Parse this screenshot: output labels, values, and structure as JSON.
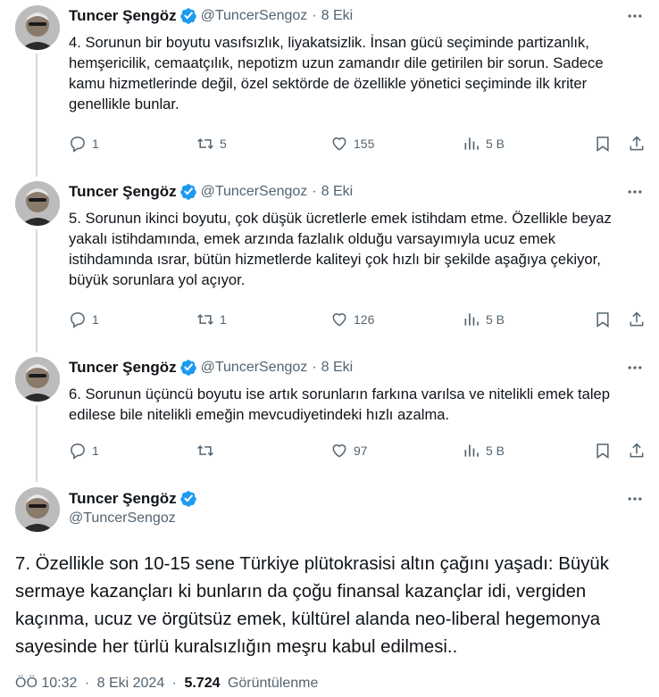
{
  "author": {
    "name": "Tuncer Şengöz",
    "handle": "@TuncerSengoz",
    "verified_color": "#1d9bf0"
  },
  "tweets": [
    {
      "date": "8 Eki",
      "text": "4. Sorunun bir boyutu vasıfsızlık, liyakatsizlik. İnsan gücü seçiminde partizanlık, hemşericilik, cemaatçılık, nepotizm uzun zamandır dile getirilen bir sorun. Sadece kamu hizmetlerinde değil, özel sektörde de özellikle yönetici seçiminde ilk kriter genellikle bunlar.",
      "replies": "1",
      "retweets": "5",
      "likes": "155",
      "views": "5 B"
    },
    {
      "date": "8 Eki",
      "text": "5. Sorunun ikinci boyutu, çok düşük ücretlerle emek istihdam etme. Özellikle beyaz yakalı istihdamında, emek arzında fazlalık olduğu varsayımıyla ucuz emek istihdamında ısrar, bütün hizmetlerde kaliteyi çok hızlı bir şekilde aşağıya çekiyor, büyük sorunlara yol açıyor.",
      "replies": "1",
      "retweets": "1",
      "likes": "126",
      "views": "5 B"
    },
    {
      "date": "8 Eki",
      "text": "6. Sorunun üçüncü boyutu ise artık sorunların farkına varılsa ve nitelikli emek talep edilese bile nitelikli emeğin mevcudiyetindeki hızlı azalma.",
      "replies": "1",
      "retweets": "",
      "likes": "97",
      "views": "5 B"
    }
  ],
  "main_tweet": {
    "text": "7. Özellikle son 10-15 sene Türkiye plütokrasisi altın çağını yaşadı: Büyük sermaye kazançları ki bunların da çoğu finansal kazançlar idi, vergiden kaçınma, ucuz ve örgütsüz emek, kültürel alanda neo-liberal hegemonya sayesinde her türlü kuralsızlığın meşru kabul edilmesi..",
    "time": "ÖÖ 10:32",
    "date": "8 Eki 2024",
    "views_count": "5.724",
    "views_label": "Görüntülenme"
  },
  "separator": "·",
  "icons": {
    "reply": "reply-icon",
    "retweet": "retweet-icon",
    "like": "heart-icon",
    "views": "analytics-icon",
    "bookmark": "bookmark-icon",
    "share": "share-icon",
    "more": "more-icon",
    "verified": "verified-badge-icon"
  }
}
